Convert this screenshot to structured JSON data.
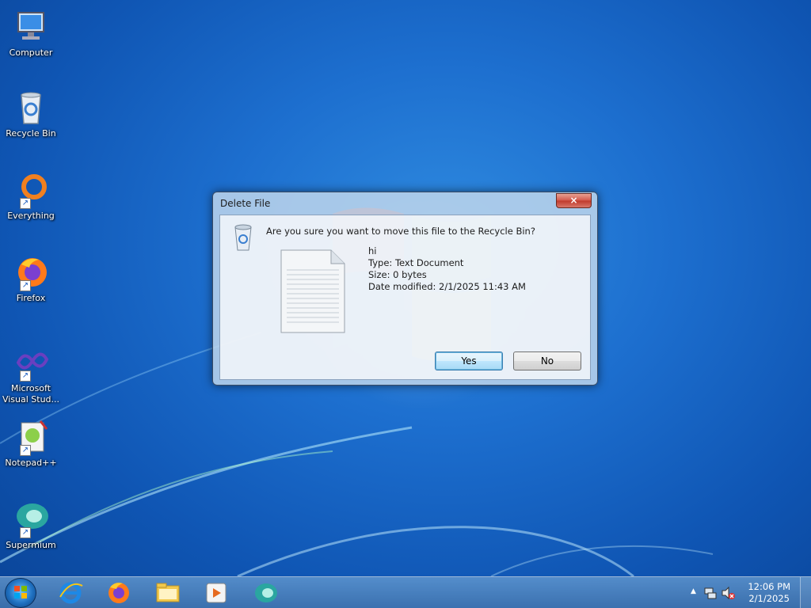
{
  "desktop": {
    "icons": [
      {
        "label": "Computer",
        "icon": "computer-icon"
      },
      {
        "label": "Recycle Bin",
        "icon": "recycle-bin-icon"
      },
      {
        "label": "Everything",
        "icon": "everything-icon"
      },
      {
        "label": "Firefox",
        "icon": "firefox-icon"
      },
      {
        "label": "Microsoft Visual Stud...",
        "icon": "visual-studio-icon"
      },
      {
        "label": "Notepad++",
        "icon": "notepadpp-icon"
      },
      {
        "label": "Supermium",
        "icon": "supermium-icon"
      }
    ]
  },
  "dialog": {
    "title": "Delete File",
    "close_label": "×",
    "question": "Are you sure you want to move this file to the Recycle Bin?",
    "file": {
      "name": "hi",
      "type": "Type: Text Document",
      "size": "Size: 0 bytes",
      "modified": "Date modified: 2/1/2025 11:43 AM"
    },
    "yes_label": "Yes",
    "no_label": "No"
  },
  "taskbar": {
    "pinned": [
      "internet-explorer-icon",
      "firefox-icon",
      "file-explorer-icon",
      "media-player-icon",
      "supermium-icon"
    ],
    "tray": {
      "time": "12:06 PM",
      "date": "2/1/2025",
      "show_hidden_label": "▲"
    }
  },
  "colors": {
    "desktop_bg": "#1d6fcf",
    "taskbar": "#4f86bd",
    "close_button": "#c0392b"
  }
}
